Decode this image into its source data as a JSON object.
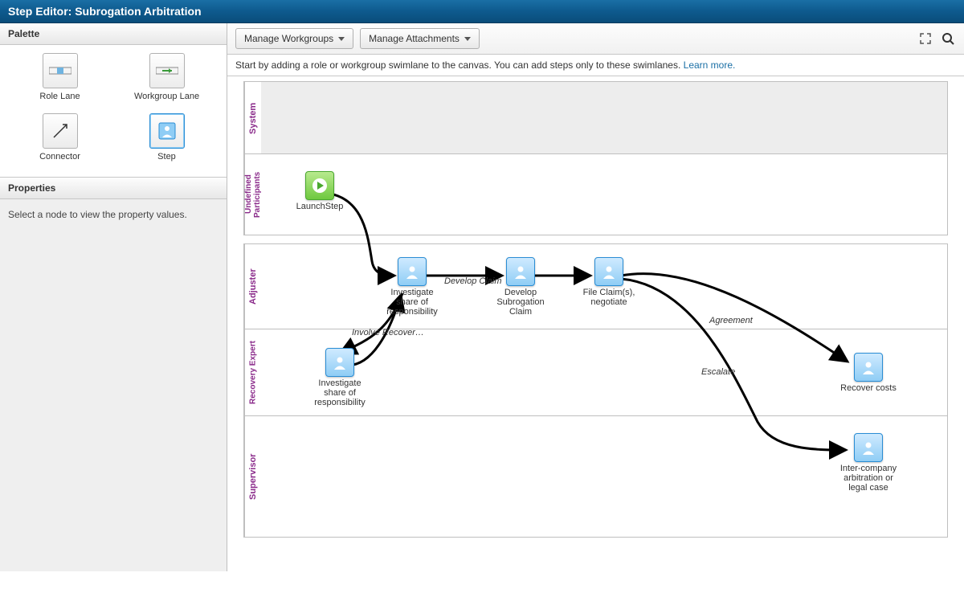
{
  "title": "Step Editor: Subrogation Arbitration",
  "palette": {
    "header": "Palette",
    "role": "Role Lane",
    "workgroup": "Workgroup Lane",
    "connector": "Connector",
    "step": "Step"
  },
  "properties": {
    "header": "Properties",
    "empty": "Select a node to view the property values."
  },
  "toolbar": {
    "manage_workgroups": "Manage Workgroups",
    "manage_attachments": "Manage Attachments"
  },
  "hint": {
    "text": "Start by adding a role or workgroup swimlane to the canvas. You can add steps only to these swimlanes. ",
    "link": "Learn more."
  },
  "lanes": {
    "system": "System",
    "undef": "Undefined Participants",
    "adjuster": "Adjuster",
    "recovery": "Recovery Expert",
    "supervisor": "Supervisor"
  },
  "nodes": {
    "launch": "LaunchStep",
    "adj_investigate": "Investigate share of responsibility",
    "develop": "Develop Subrogation Claim",
    "file": "File Claim(s), negotiate",
    "rec_investigate": "Investigate share of responsibility",
    "recover": "Recover costs",
    "supervisor": "Inter-company arbitration or legal case"
  },
  "edges": {
    "develop_claim": "Develop Claim",
    "involve": "Involve Recover…",
    "agreement": "Agreement",
    "escalate": "Escalate"
  }
}
